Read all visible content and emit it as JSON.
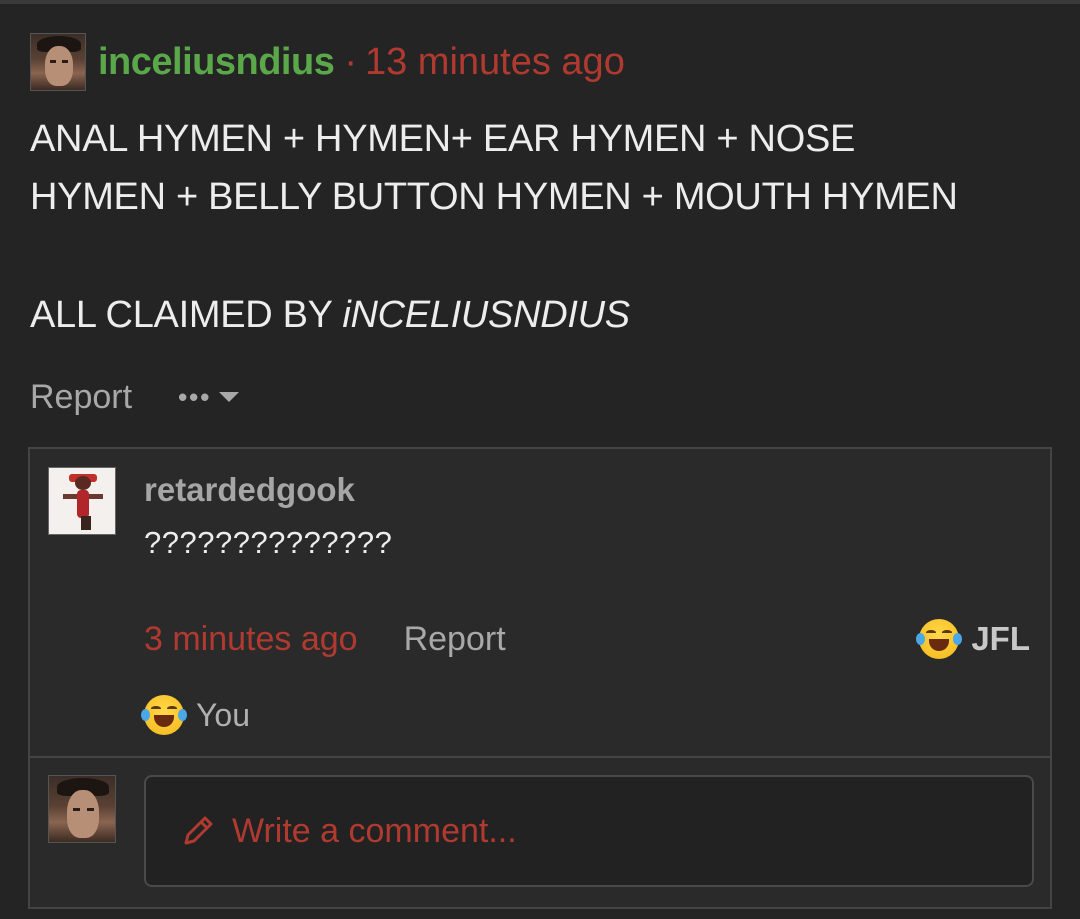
{
  "post": {
    "author": "inceliusndius",
    "separator": "·",
    "time": "13 minutes ago",
    "body_line1": "ANAL HYMEN + HYMEN+ EAR HYMEN + NOSE",
    "body_line2": "HYMEN + BELLY BUTTON HYMEN + MOUTH HYMEN",
    "claim_prefix": "ALL CLAIMED BY ",
    "claim_name": "iNCELIUSNDIUS",
    "report_label": "Report",
    "more_label": "•••"
  },
  "comment": {
    "author": "retardedgook",
    "text": "??????????????",
    "time": "3 minutes ago",
    "report_label": "Report",
    "reaction_label": "JFL",
    "reaction_by": "You",
    "reaction_icon": "laughing-crying-emoji-icon"
  },
  "reply": {
    "placeholder": "Write a comment...",
    "icon": "pencil-icon"
  },
  "colors": {
    "background": "#242424",
    "username": "#5aa84a",
    "timestamp": "#b03a30",
    "muted": "#a8a8a8"
  }
}
